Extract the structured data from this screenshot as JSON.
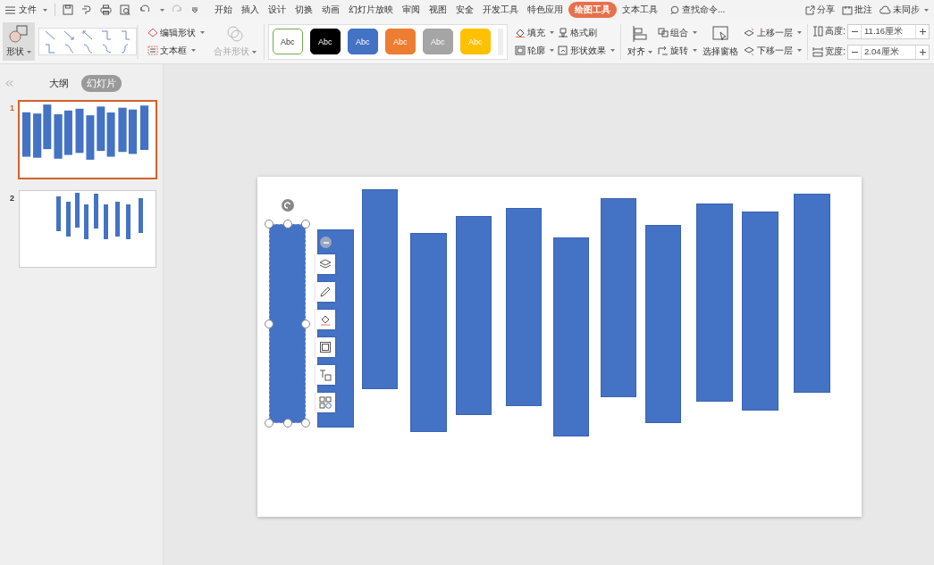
{
  "menu": {
    "label": "文件"
  },
  "tabs": [
    {
      "label": "开始",
      "selected": false
    },
    {
      "label": "插入",
      "selected": false
    },
    {
      "label": "设计",
      "selected": false
    },
    {
      "label": "切换",
      "selected": false
    },
    {
      "label": "动画",
      "selected": false
    },
    {
      "label": "幻灯片放映",
      "selected": false
    },
    {
      "label": "审阅",
      "selected": false
    },
    {
      "label": "视图",
      "selected": false
    },
    {
      "label": "安全",
      "selected": false
    },
    {
      "label": "开发工具",
      "selected": false
    },
    {
      "label": "特色应用",
      "selected": false
    },
    {
      "label": "绘图工具",
      "selected": true
    },
    {
      "label": "文本工具",
      "selected": false
    }
  ],
  "search": {
    "placeholder": "查找命令..."
  },
  "top_actions": [
    "分享",
    "批注",
    "未同步"
  ],
  "ribbon": {
    "shape_button": "形状",
    "edit_shape": "编辑形状",
    "text_box": "文本框",
    "merge_shapes": {
      "label": "合并形状",
      "disabled": true
    },
    "styles": [
      {
        "label": "Abc",
        "kind": "outline",
        "color": "#70ad47"
      },
      {
        "label": "Abc",
        "kind": "filled",
        "color": "#000000"
      },
      {
        "label": "Abc",
        "kind": "filled",
        "color": "#4472c4"
      },
      {
        "label": "Abc",
        "kind": "filled",
        "color": "#ed7d31"
      },
      {
        "label": "Abc",
        "kind": "filled",
        "color": "#a5a5a5"
      },
      {
        "label": "Abc",
        "kind": "filled",
        "color": "#ffc000"
      }
    ],
    "fill": "填充",
    "format_painter": "格式刷",
    "outline": "轮廓",
    "shape_effects": "形状效果",
    "align": "对齐",
    "group": "组合",
    "rotate": "旋转",
    "selection_pane": "选择窗格",
    "bring_forward": "上移一层",
    "send_backward": "下移一层",
    "height": {
      "label": "高度:",
      "value": "11.16厘米"
    },
    "width": {
      "label": "宽度:",
      "value": "2.04厘米"
    }
  },
  "panel": {
    "tabs": [
      {
        "label": "大纲",
        "selected": false
      },
      {
        "label": "幻灯片",
        "selected": true
      }
    ],
    "slides": [
      {
        "number": "1",
        "selected": true
      },
      {
        "number": "2",
        "selected": false
      }
    ]
  },
  "slide": {
    "shapes": [
      {
        "selected": true
      },
      {
        "selected": false
      },
      {
        "selected": false
      },
      {
        "selected": false
      },
      {
        "selected": false
      },
      {
        "selected": false
      },
      {
        "selected": false
      },
      {
        "selected": false
      },
      {
        "selected": false
      },
      {
        "selected": false
      },
      {
        "selected": false
      },
      {
        "selected": false
      }
    ]
  }
}
